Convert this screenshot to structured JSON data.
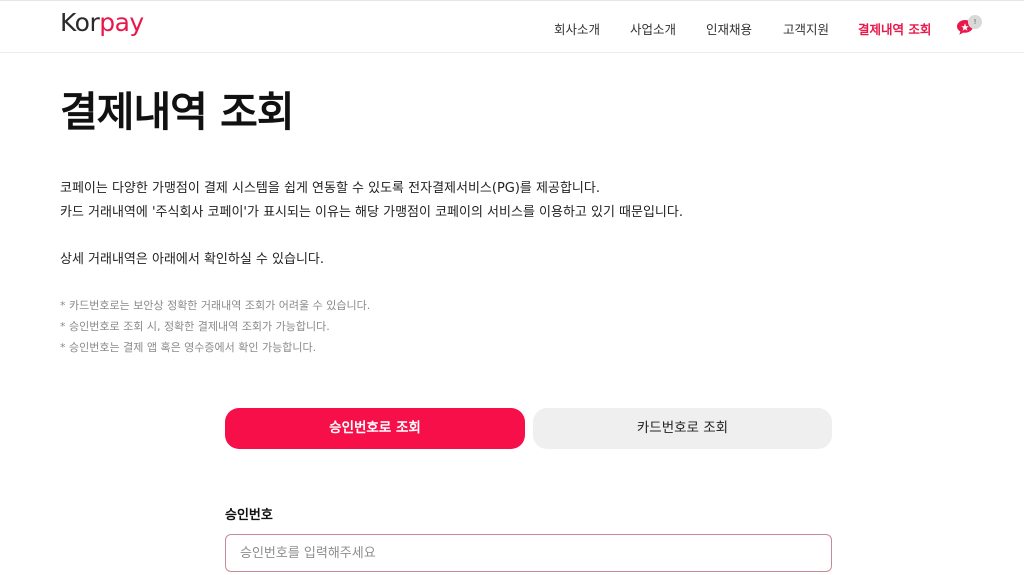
{
  "brand": {
    "logo_part1": "Kor",
    "logo_part2": "pay",
    "accent": "#e8194a"
  },
  "nav": {
    "items": [
      {
        "label": "회사소개"
      },
      {
        "label": "사업소개"
      },
      {
        "label": "인재채용"
      },
      {
        "label": "고객지원"
      },
      {
        "label": "결제내역 조회",
        "active": true
      }
    ],
    "chat_badge": "!"
  },
  "page": {
    "title": "결제내역 조회",
    "intro": [
      "코페이는 다양한 가맹점이 결제 시스템을 쉽게 연동할 수 있도록 전자결제서비스(PG)를 제공합니다.",
      "카드 거래내역에 '주식회사 코페이'가 표시되는 이유는 해당 가맹점이 코페이의 서비스를 이용하고 있기 때문입니다.",
      "상세 거래내역은 아래에서 확인하실 수 있습니다."
    ],
    "notes": [
      "* 카드번호로는 보안상 정확한 거래내역 조회가 어려울 수 있습니다.",
      "* 승인번호로 조회 시, 정확한 결제내역 조회가 가능합니다.",
      "* 승인번호는 결제 앱 혹은 영수증에서 확인 가능합니다."
    ]
  },
  "tabs": {
    "approval": "승인번호로 조회",
    "card": "카드번호로 조회",
    "active": "approval",
    "active_color": "#f70f49"
  },
  "form": {
    "label": "승인번호",
    "placeholder": "승인번호를 입력해주세요",
    "value": ""
  }
}
